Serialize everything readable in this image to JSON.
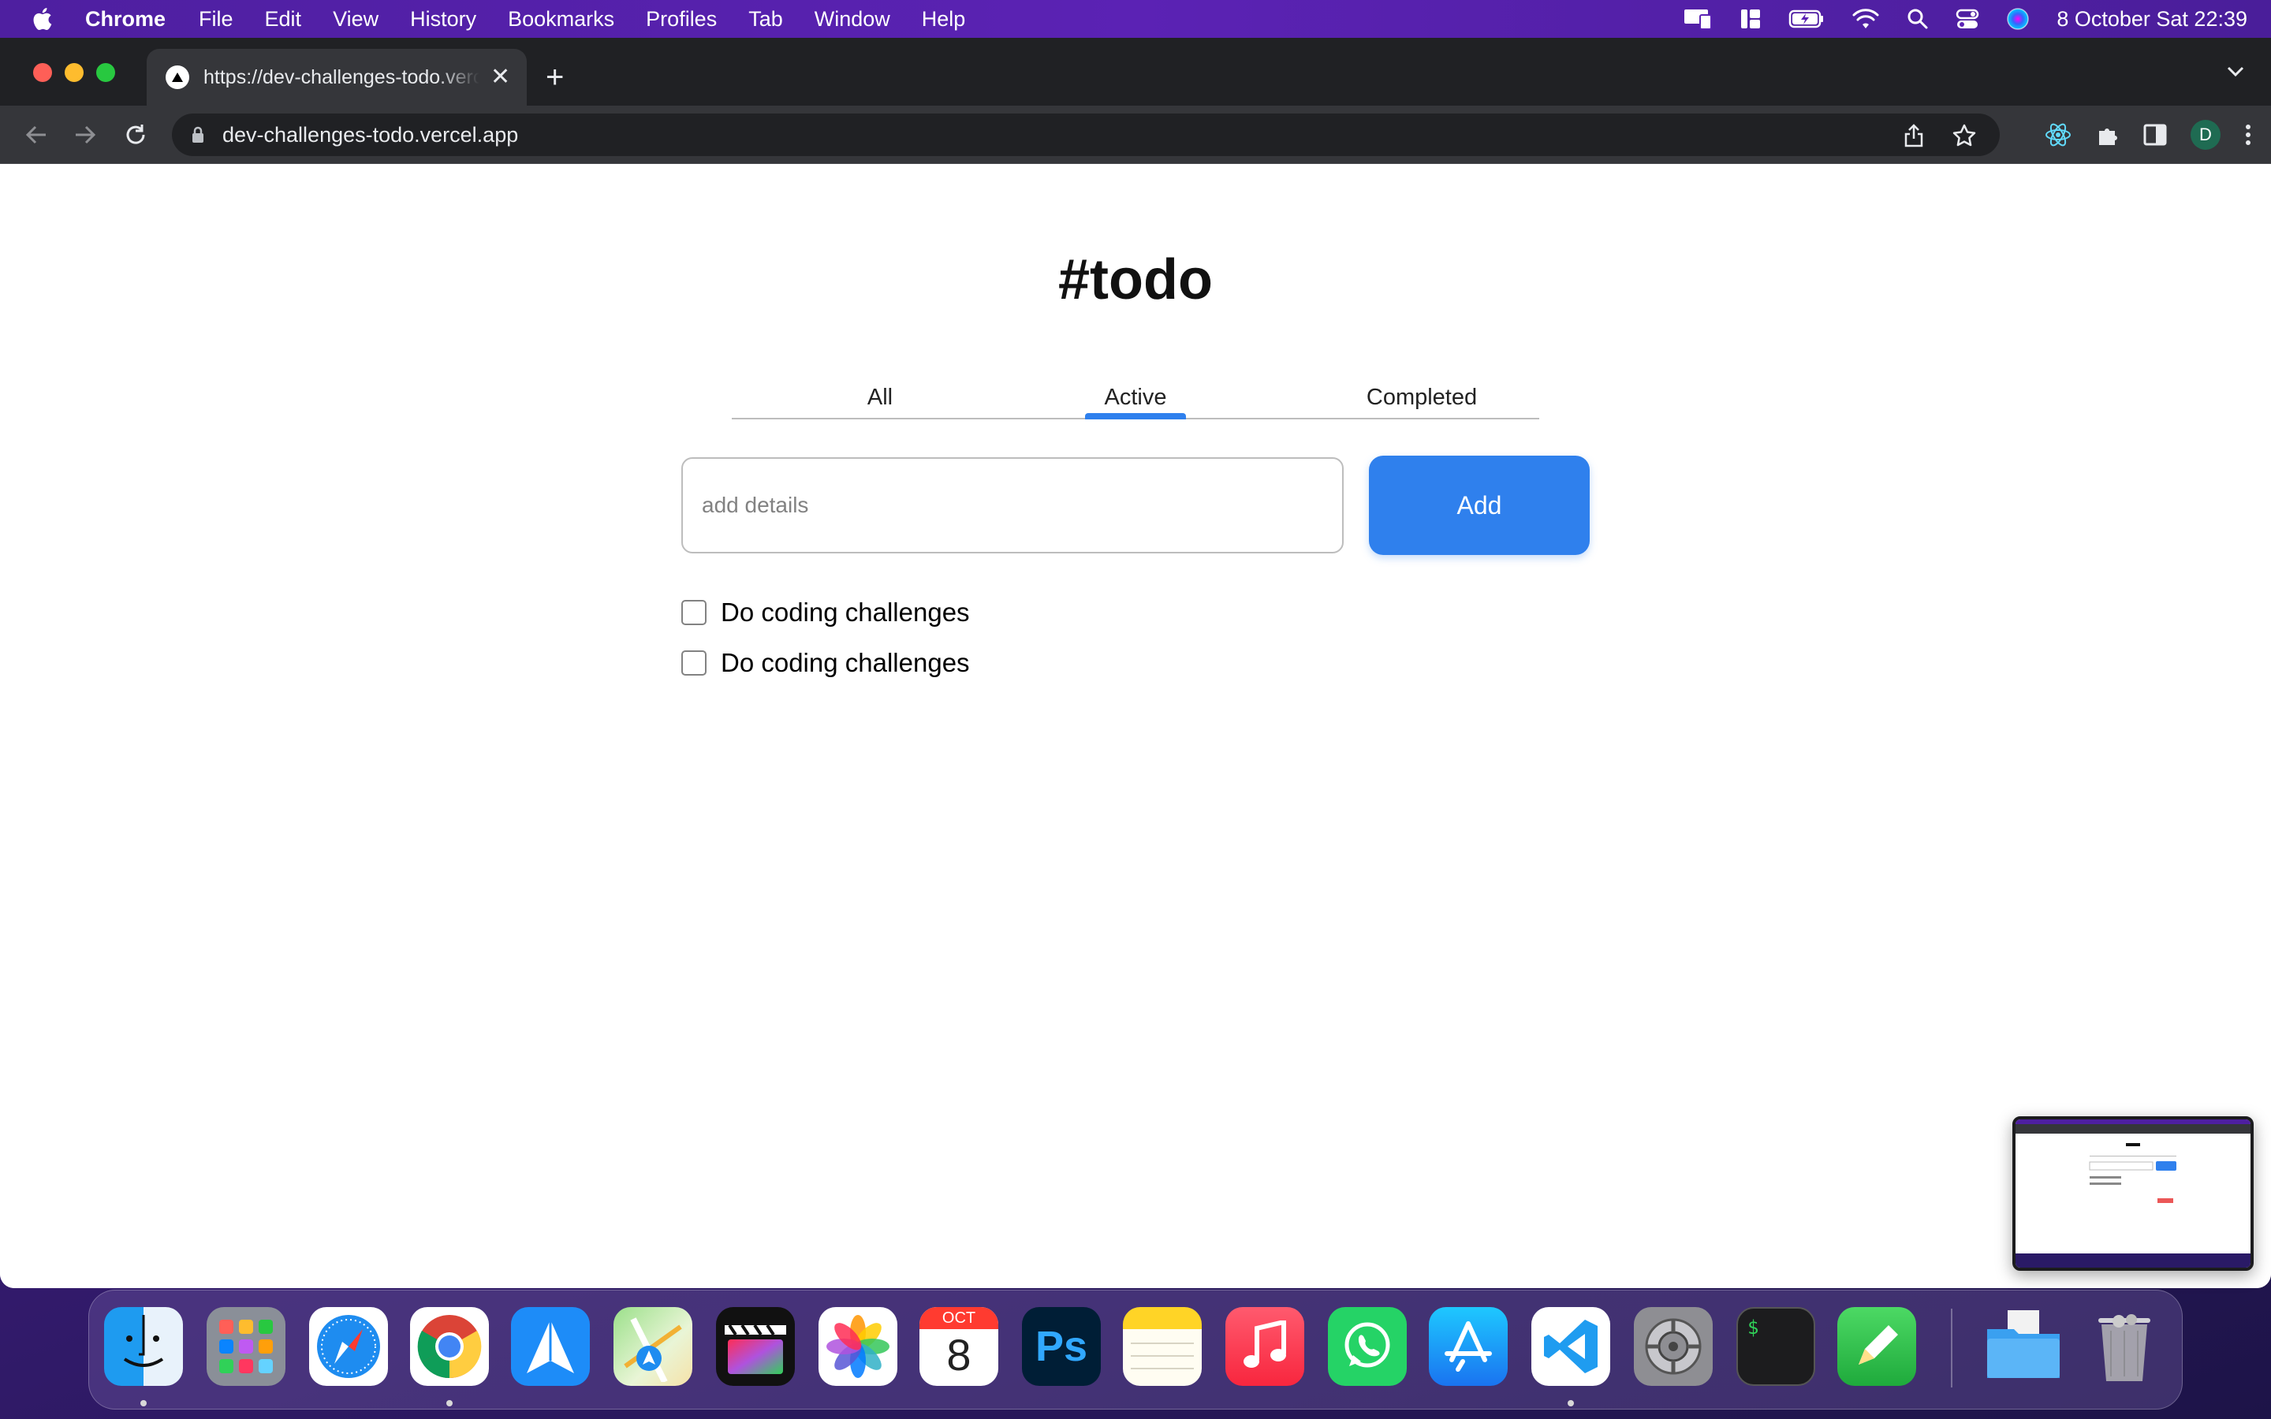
{
  "menubar": {
    "app_name": "Chrome",
    "items": [
      "File",
      "Edit",
      "View",
      "History",
      "Bookmarks",
      "Profiles",
      "Tab",
      "Window",
      "Help"
    ],
    "clock": "8 October Sat  22:39",
    "status_icons": [
      "screen-mirroring-icon",
      "stage-manager-icon",
      "battery-icon",
      "wifi-icon",
      "spotlight-search-icon",
      "control-center-icon",
      "siri-icon"
    ]
  },
  "browser": {
    "tab_title": "https://dev-challenges-todo.vercel.app",
    "new_tab_symbol": "+",
    "close_symbol": "✕",
    "url": "dev-challenges-todo.vercel.app",
    "profile_initial": "D",
    "colors": {
      "frame": "#202124",
      "toolbar": "#35363a",
      "avatar": "#1f6b52"
    }
  },
  "page": {
    "title": "#todo",
    "tabs": [
      {
        "label": "All",
        "selected": false
      },
      {
        "label": "Active",
        "selected": true
      },
      {
        "label": "Completed",
        "selected": false
      }
    ],
    "input": {
      "placeholder": "add details",
      "value": ""
    },
    "add_label": "Add",
    "todos": [
      {
        "text": "Do coding challenges",
        "checked": false
      },
      {
        "text": "Do coding challenges",
        "checked": false
      }
    ],
    "colors": {
      "accent": "#2f80ed",
      "border": "#bdbdbd"
    }
  },
  "dock": {
    "apps": [
      "Finder",
      "Launchpad",
      "Safari",
      "Chrome",
      "Spark",
      "Maps",
      "Final Cut Pro",
      "Photos",
      "Calendar",
      "Photoshop",
      "Notes",
      "Music",
      "WhatsApp",
      "App Store",
      "Visual Studio Code",
      "System Preferences",
      "Terminal",
      "Sketchbook",
      "Downloads",
      "Trash"
    ],
    "calendar_month": "OCT",
    "calendar_day": "8",
    "photoshop_label": "Ps",
    "terminal_prompt": "$"
  }
}
